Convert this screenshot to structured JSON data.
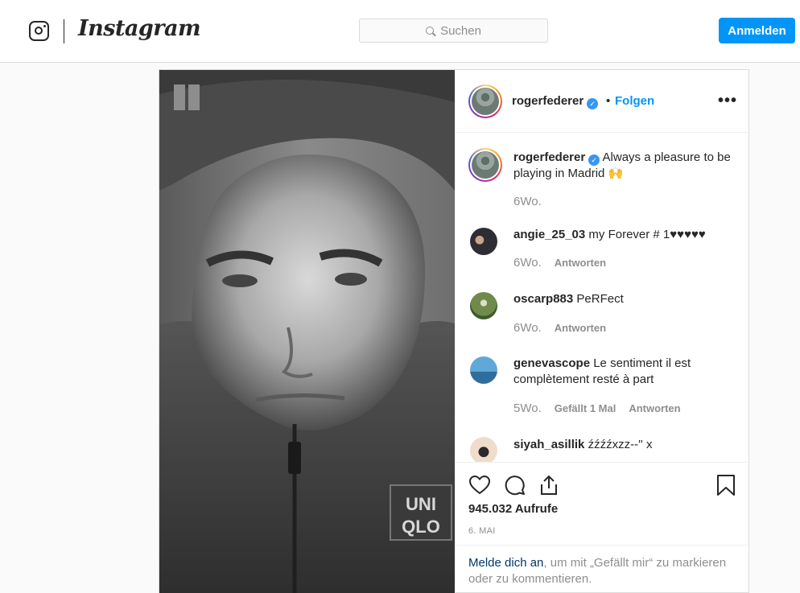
{
  "header": {
    "brand": "Instagram",
    "search_placeholder": "Suchen",
    "login_button": "Anmelden"
  },
  "post": {
    "author": "rogerfederer",
    "separator": "•",
    "follow_label": "Folgen",
    "more_label": "•••",
    "caption": "Always a pleasure to be playing in Madrid 🙌",
    "caption_age": "6Wo.",
    "comments": [
      {
        "user": "angie_25_03",
        "text": "my Forever # 1♥♥♥♥♥",
        "age": "6Wo.",
        "likes": "",
        "reply": "Antworten"
      },
      {
        "user": "oscarp883",
        "text": "PeRFect",
        "age": "6Wo.",
        "likes": "",
        "reply": "Antworten"
      },
      {
        "user": "genevascope",
        "text": "Le sentiment il est complètement resté à part",
        "age": "5Wo.",
        "likes": "Gefällt 1 Mal",
        "reply": "Antworten"
      },
      {
        "user": "siyah_asillik",
        "text": "źźźźxzz--'' x"
      }
    ],
    "views": "945.032 Aufrufe",
    "date": "6. MAI",
    "login_prompt": {
      "link": "Melde dich an",
      "rest": ", um mit „Gefällt mir“ zu markieren oder zu kommentieren."
    },
    "media_text": {
      "logo_top": "UNI",
      "logo_bottom": "QLO"
    }
  },
  "icons": [
    "instagram-glyph-icon",
    "search-icon",
    "verified-icon",
    "more-icon",
    "heart-icon",
    "comment-icon",
    "share-icon",
    "bookmark-icon"
  ],
  "colors": {
    "accent": "#0095f6",
    "verified": "#3897f0",
    "text": "#262626",
    "muted": "#8e8e8e",
    "link": "#00376b"
  }
}
